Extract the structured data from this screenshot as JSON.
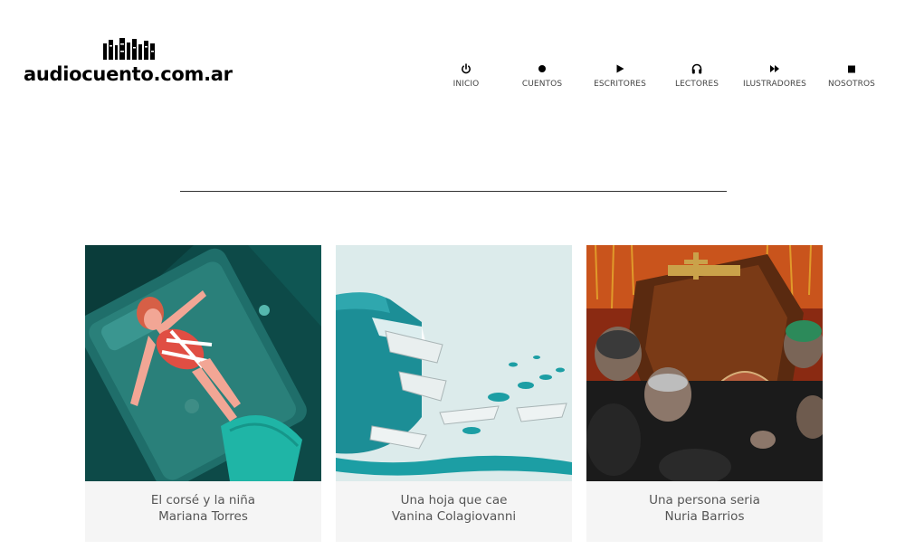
{
  "site": {
    "logo_text": "audiocuento.com.ar",
    "logo_icon": "books-icon"
  },
  "nav": [
    {
      "label": "INICIO",
      "icon": "power-icon"
    },
    {
      "label": "CUENTOS",
      "icon": "dot-icon"
    },
    {
      "label": "ESCRITORES",
      "icon": "play-icon"
    },
    {
      "label": "LECTORES",
      "icon": "headphones-icon"
    },
    {
      "label": "ILUSTRADORES",
      "icon": "fast-forward-icon"
    },
    {
      "label": "NOSOTROS",
      "icon": "stop-icon"
    }
  ],
  "cards": [
    {
      "title": "El corsé y la niña",
      "author": "Mariana Torres"
    },
    {
      "title": "Una hoja que cae",
      "author": "Vanina Colagiovanni"
    },
    {
      "title": "Una persona seria",
      "author": "Nuria Barrios"
    }
  ],
  "colors": {
    "accent_teal": "#1a9e96",
    "background": "#ffffff",
    "caption_bg": "#f5f5f5"
  }
}
